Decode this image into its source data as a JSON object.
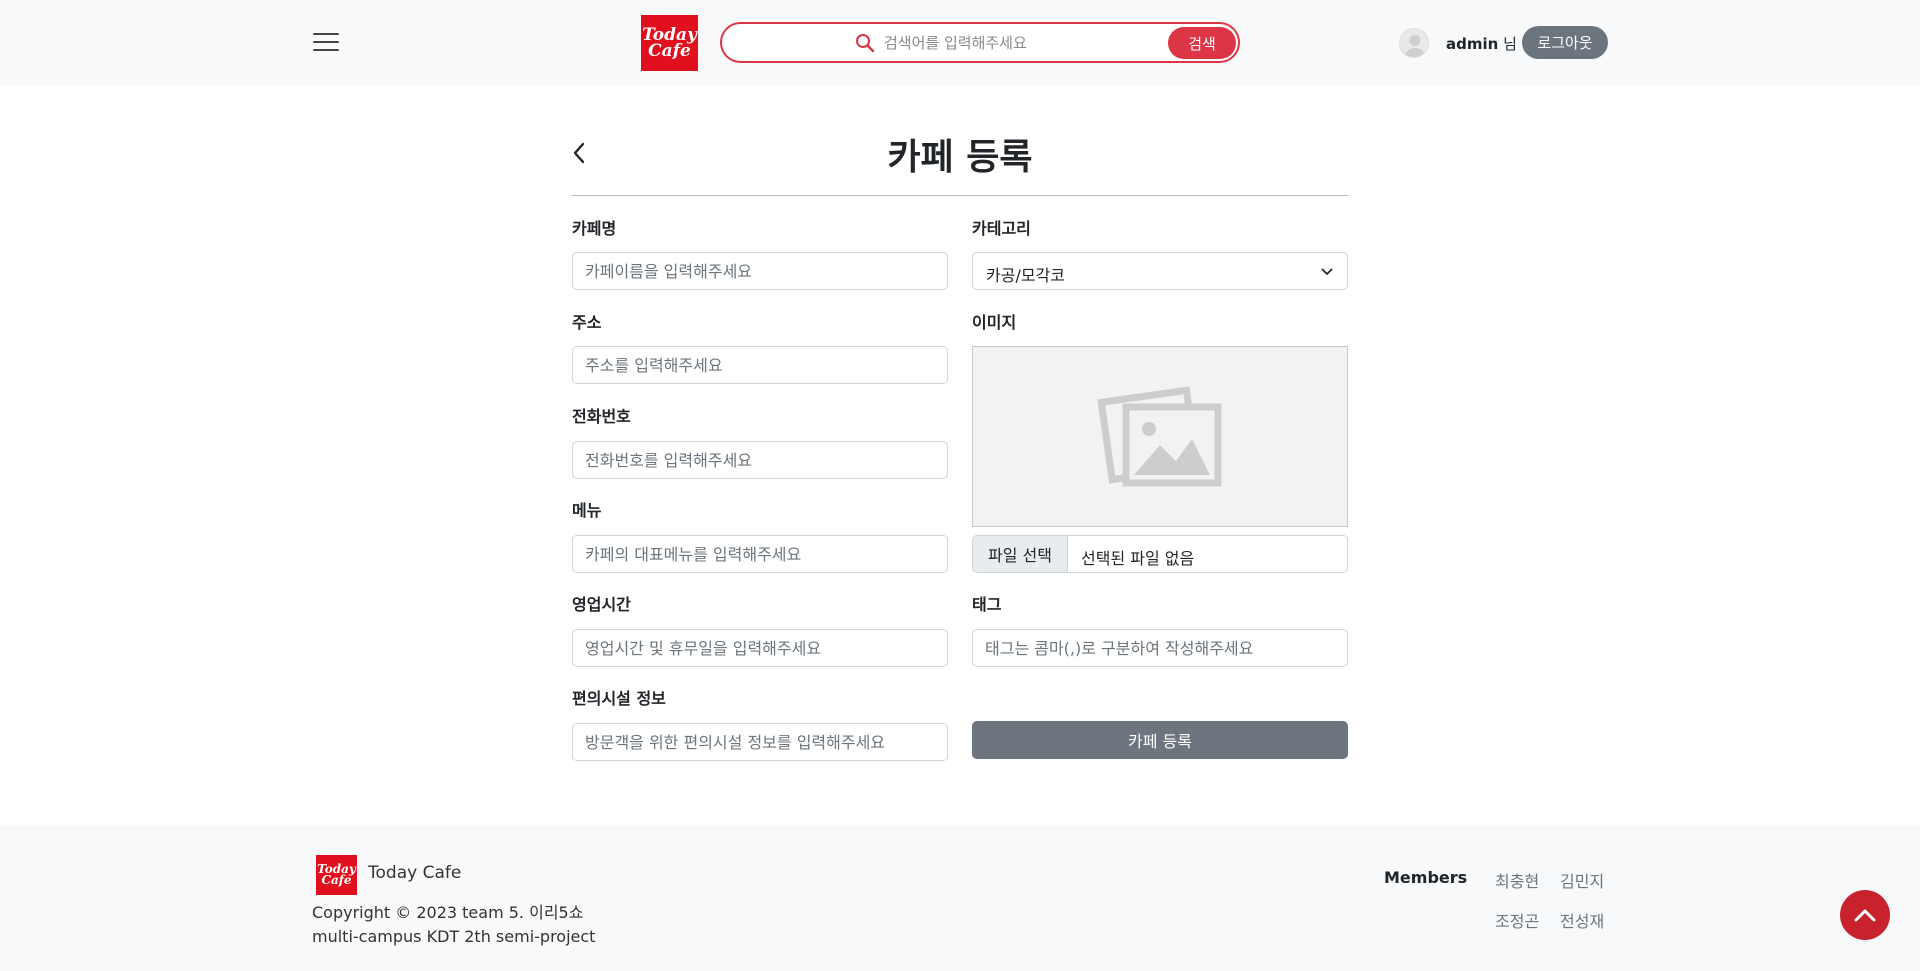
{
  "header": {
    "logo_line1": "Today",
    "logo_line2": "Cafe",
    "search_placeholder": "검색어를 입력해주세요",
    "search_button": "검색",
    "username": "admin",
    "username_suffix": " 님",
    "logout_button": "로그아웃",
    "accent_color": "#dc3545"
  },
  "page": {
    "title": "카페 등록"
  },
  "form": {
    "name": {
      "label": "카페명",
      "placeholder": "카페이름을 입력해주세요"
    },
    "address": {
      "label": "주소",
      "placeholder": "주소를 입력해주세요"
    },
    "phone": {
      "label": "전화번호",
      "placeholder": "전화번호를 입력해주세요"
    },
    "menu": {
      "label": "메뉴",
      "placeholder": "카페의 대표메뉴를 입력해주세요"
    },
    "hours": {
      "label": "영업시간",
      "placeholder": "영업시간 및 휴무일을 입력해주세요"
    },
    "facilities": {
      "label": "편의시설 정보",
      "placeholder": "방문객을 위한 편의시설 정보를 입력해주세요"
    },
    "category": {
      "label": "카테고리",
      "selected": "카공/모각코"
    },
    "image": {
      "label": "이미지",
      "file_button": "파일 선택",
      "file_status": "선택된 파일 없음"
    },
    "tags": {
      "label": "태그",
      "placeholder": "태그는 콤마(,)로 구분하여 작성해주세요"
    },
    "submit": "카페 등록"
  },
  "footer": {
    "logo_line1": "Today",
    "logo_line2": "Cafe",
    "brand": "Today Cafe",
    "copyright": "Copyright © 2023 team 5. 이리5쇼",
    "project": "multi-campus KDT 2th semi-project",
    "members_label": "Members",
    "members": [
      "최충현",
      "김민지",
      "조정곤",
      "전성재"
    ]
  }
}
